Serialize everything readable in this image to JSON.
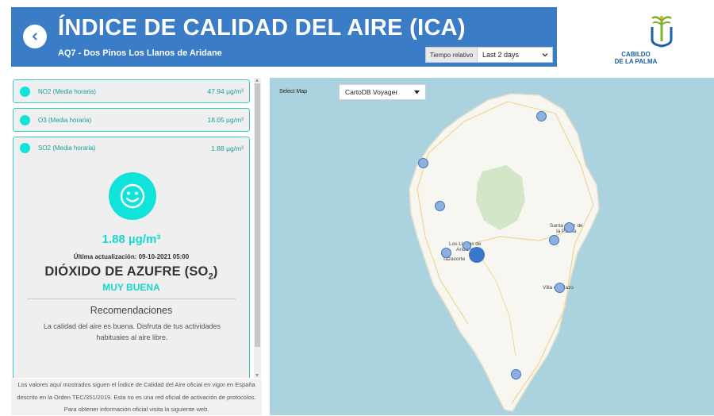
{
  "header": {
    "title": "ÍNDICE DE CALIDAD DEL AIRE (ICA)",
    "subtitle": "AQ7 - Dos Pinos Los Llanos de Aridane",
    "time_label": "Tiempo relativo",
    "time_value": "Last 2 days"
  },
  "logo": {
    "line1": "CABILDO",
    "line2": "DE LA PALMA"
  },
  "cards": [
    {
      "name": "NO2 (Media horaria)",
      "value": "47.94 µg/m³"
    },
    {
      "name": "O3 (Media horaria)",
      "value": "18.05 µg/m³"
    },
    {
      "name": "SO2 (Media horaria)",
      "value": "1.88 µg/m³"
    }
  ],
  "detail": {
    "value": "1.88 µg/m³",
    "updated": "Última actualización: 09-10-2021 05:00",
    "pollutant_name": "DIÓXIDO DE AZUFRE (SO",
    "pollutant_sub": "2",
    "pollutant_close": ")",
    "quality": "MUY BUENA",
    "rec_title": "Recomendaciones",
    "rec_text": "La calidad del aire es buena. Disfruta de tus actividades habituales al aire libre."
  },
  "footer": "Los valores aquí mostrados siguen el Índice de Calidad del Aire oficial en vigor en España descrito en la Orden TEC/351/2019. Esta no es una red oficial de activación de protocolos. Para obtener información oficial visita la siguiente web.",
  "map": {
    "select_label": "Select Map",
    "select_value": "CartoDB Voyager",
    "places": [
      "Los Llanos de",
      "Aridane",
      "Tazacorte",
      "Santa Cruz de",
      "la Palma",
      "Villa de Mazo"
    ]
  },
  "colors": {
    "header": "#3a7cc6",
    "accent": "#10e3d9",
    "sea": "#aad3df",
    "station": "#3a76c9"
  }
}
